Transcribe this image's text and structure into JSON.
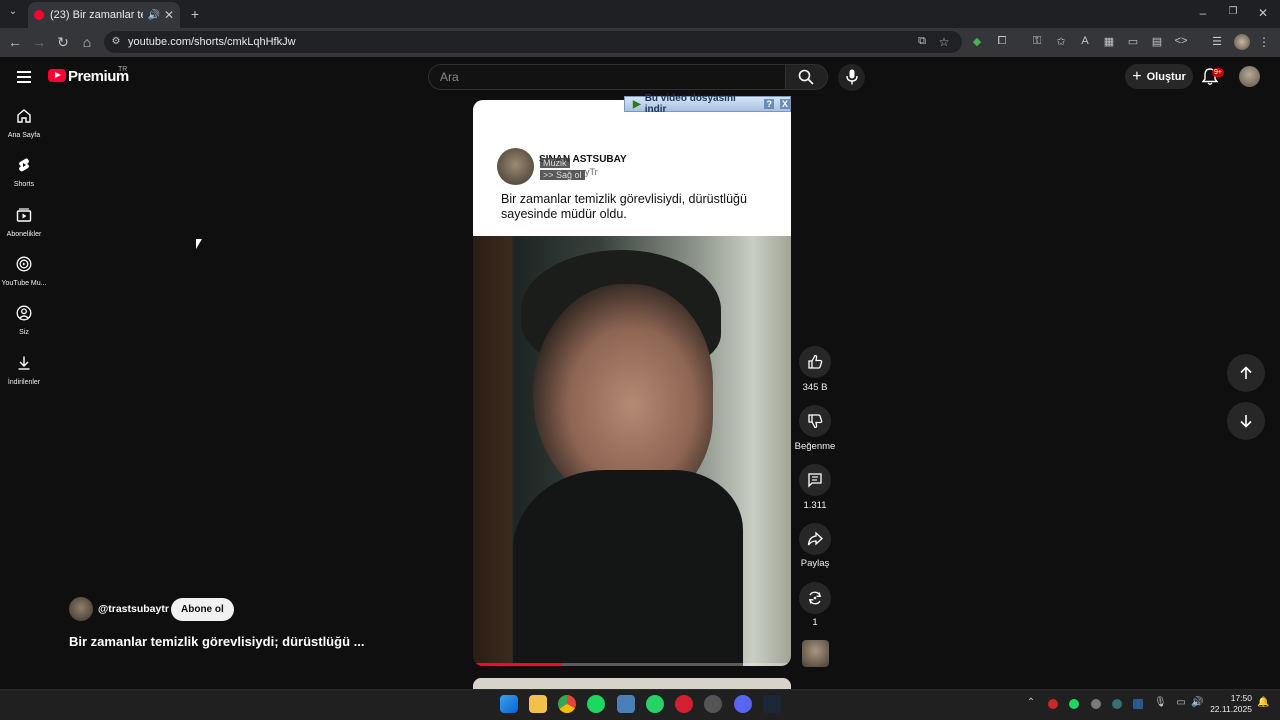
{
  "browser": {
    "tab_title": "(23) Bir zamanlar temizlik g",
    "url": "youtube.com/shorts/cmkLqhHfkJw"
  },
  "header": {
    "logo_text": "Premium",
    "logo_region": "TR",
    "search_placeholder": "Ara",
    "create_label": "Oluştur",
    "notif_badge": "9+"
  },
  "sidebar": {
    "items": [
      {
        "label": "Ana Sayfa",
        "icon": "home-icon"
      },
      {
        "label": "Shorts",
        "icon": "shorts-icon"
      },
      {
        "label": "Abonelikler",
        "icon": "subscriptions-icon"
      },
      {
        "label": "YouTube Mu...",
        "icon": "youtube-music-icon"
      },
      {
        "label": "Siz",
        "icon": "you-icon"
      },
      {
        "label": "İndirilenler",
        "icon": "downloads-icon"
      }
    ]
  },
  "short": {
    "overlay_channel": "SINAN ASTSUBAY",
    "overlay_handle": "yTr",
    "music_tag": "Müzik",
    "thanks_tag": ">> Sağ ol",
    "overlay_caption": "Bir zamanlar temizlik görevlisiydi, dürüstlüğü sayesinde müdür oldu.",
    "download_bar": "Bu video dosyasını indir",
    "download_help": "?",
    "download_close": "X",
    "progress": 0.28
  },
  "actions": {
    "like_count": "345 B",
    "dislike_label": "Beğenme",
    "comment_count": "1.311",
    "share_label": "Paylaş",
    "remix_count": "1"
  },
  "channel": {
    "handle": "@trastsubaytr",
    "subscribe_label": "Abone ol",
    "title": "Bir zamanlar temizlik görevlisiydi; dürüstlüğü ..."
  },
  "taskbar": {
    "time": "17:50",
    "date": "22.11.2025"
  },
  "colors": {
    "brand_red": "#ff0033",
    "background": "#0f0f0f",
    "button_bg": "#272727"
  }
}
